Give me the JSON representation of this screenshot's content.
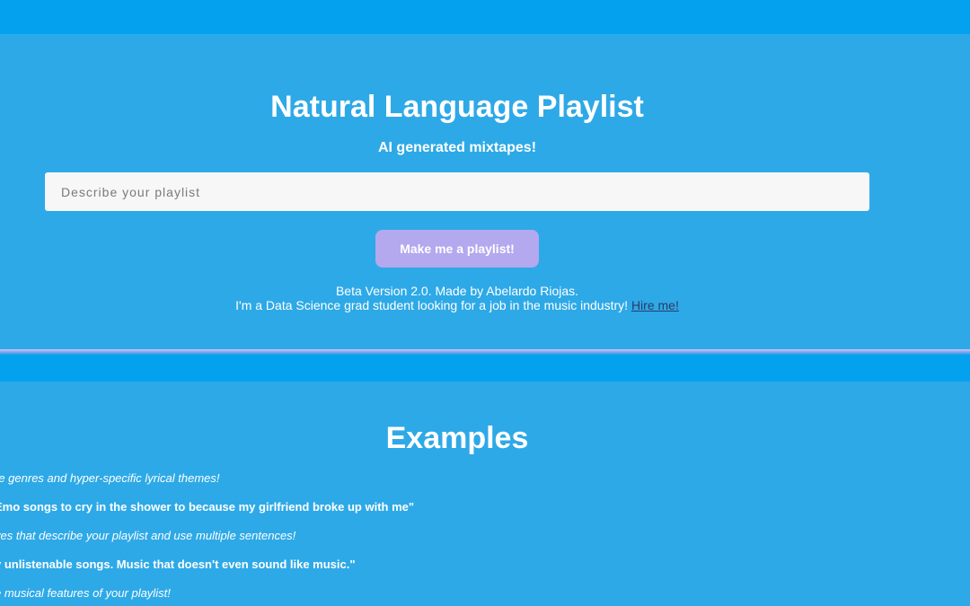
{
  "hero": {
    "title": "Natural Language Playlist",
    "subtitle": "AI generated mixtapes!",
    "input_placeholder": "Describe your playlist",
    "input_value": "",
    "button_label": "Make me a playlist!",
    "credit_line_1": "Beta Version 2.0. Made by Abelardo Riojas.",
    "credit_line_2": "I'm a Data Science grad student looking for a job in the music industry! ",
    "hire_link": "Hire me!"
  },
  "examples": {
    "title": "Examples",
    "items": [
      {
        "kind": "tip",
        "text": "re genres and hyper-specific lyrical themes!"
      },
      {
        "kind": "quote",
        "text": "Emo songs to cry in the shower to because my girlfriend broke up with me\""
      },
      {
        "kind": "tip",
        "text": "ves that describe your playlist and use multiple sentences!"
      },
      {
        "kind": "quote",
        "text": "y unlistenable songs. Music that doesn't even sound like music.\""
      },
      {
        "kind": "tip",
        "text": "e musical features of your playlist!"
      }
    ]
  },
  "colors": {
    "background": "#2ea9e7",
    "band": "#04a2ee",
    "button": "#b4a8ef",
    "input": "#f6f7f6",
    "link": "#2a3b6a"
  }
}
